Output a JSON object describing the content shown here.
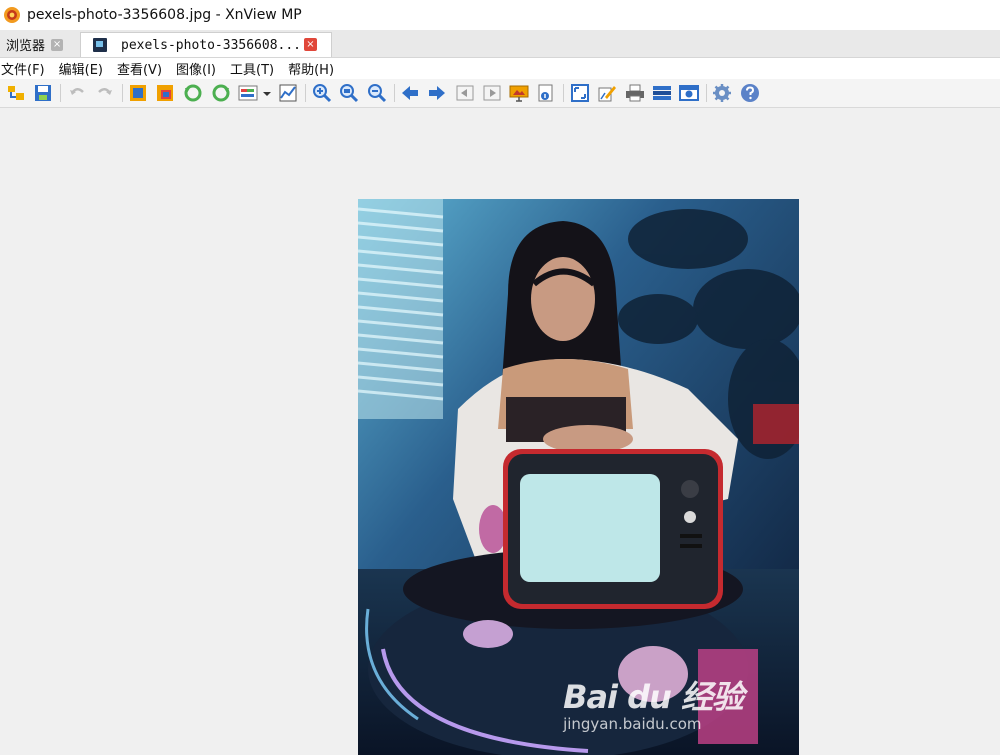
{
  "window": {
    "title": "pexels-photo-3356608.jpg - XnView MP"
  },
  "tabs": [
    {
      "label": "浏览器",
      "close": "×"
    },
    {
      "label": "pexels-photo-3356608...",
      "close": "×"
    }
  ],
  "menu": [
    "文件(F)",
    "编辑(E)",
    "查看(V)",
    "图像(I)",
    "工具(T)",
    "帮助(H)"
  ],
  "toolbar_icons": [
    "browser-icon",
    "save-icon",
    "undo-icon",
    "redo-icon",
    "crop-icon",
    "resize-icon",
    "rotate-left-icon",
    "rotate-right-icon",
    "adjust-icon",
    "histogram-icon",
    "zoom-in-icon",
    "zoom-fit-icon",
    "zoom-out-icon",
    "previous-icon",
    "next-icon",
    "first-icon",
    "last-icon",
    "slideshow-icon",
    "info-icon",
    "fullscreen-icon",
    "edit-icon",
    "print-icon",
    "scanner-icon",
    "capture-icon",
    "settings-icon",
    "help-icon"
  ],
  "colors": {
    "accent_red": "#e0473a",
    "toolbar_blue": "#2f6fc8"
  },
  "watermark": {
    "brand": "Bai du 经验",
    "url": "jingyan.baidu.com"
  }
}
